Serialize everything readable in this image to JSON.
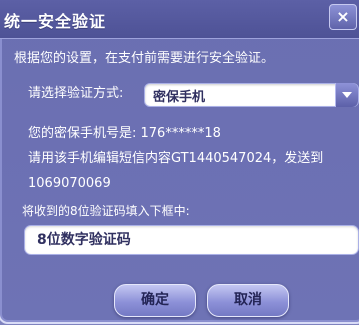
{
  "dialog": {
    "title": "统一安全验证",
    "close_label": "×",
    "intro": "根据您的设置，在支付前需要进行安全验证。",
    "method_label": "请选择验证方式:",
    "method_selected": "密保手机",
    "phone_label": "您的密保手机号是: 176******18",
    "sms_line1": "请用该手机编辑短信内容GT1440547024，发送到",
    "sms_line2": "1069070069",
    "code_label": "将收到的8位验证码填入下框中:",
    "code_placeholder": "8位数字验证码",
    "ok_label": "确定",
    "cancel_label": "取消"
  },
  "icons": {
    "close": "close-icon",
    "dropdown": "chevron-down-icon"
  },
  "colors": {
    "dialog_bg": "#6c70b3",
    "button_text": "#232455"
  }
}
